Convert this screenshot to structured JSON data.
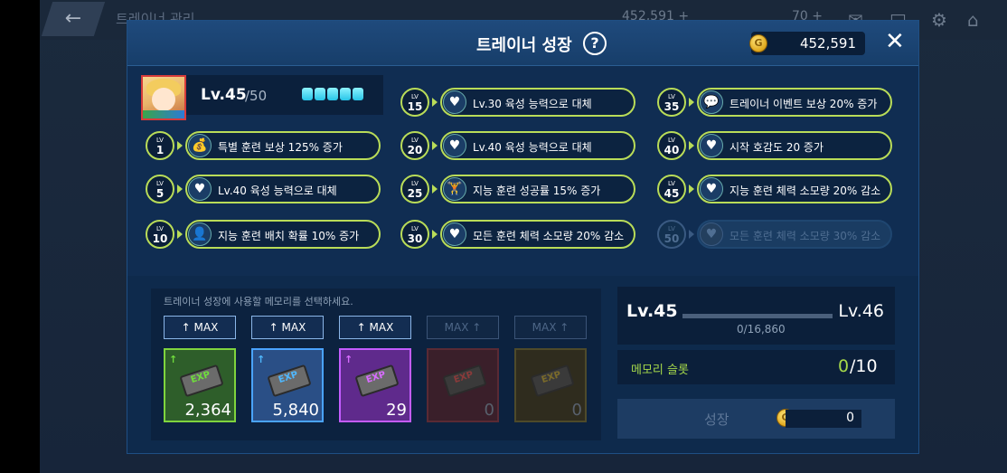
{
  "background": {
    "title": "트레이너 관리",
    "gold": "452,591 +",
    "stamina": "70 +"
  },
  "dialog": {
    "title": "트레이너 성장",
    "gold": "452,591"
  },
  "trainer": {
    "level": "Lv.45",
    "max_level": "/50",
    "gems": 5
  },
  "skills": [
    {
      "lv": "1",
      "icon": "💰",
      "text": "특별 훈련 보상 125% 증가",
      "locked": false
    },
    {
      "lv": "5",
      "icon": "♥",
      "text": "Lv.40 육성 능력으로 대체",
      "locked": false
    },
    {
      "lv": "10",
      "icon": "👤",
      "text": "지능 훈련 배치 확률 10% 증가",
      "locked": false
    },
    {
      "lv": "15",
      "icon": "♥",
      "text": "Lv.30 육성 능력으로 대체",
      "locked": false
    },
    {
      "lv": "20",
      "icon": "♥",
      "text": "Lv.40 육성 능력으로 대체",
      "locked": false
    },
    {
      "lv": "25",
      "icon": "🏋",
      "text": "지능 훈련 성공률 15% 증가",
      "locked": false
    },
    {
      "lv": "30",
      "icon": "♥",
      "text": "모든 훈련 체력 소모량 20% 감소",
      "locked": false
    },
    {
      "lv": "35",
      "icon": "💬",
      "text": "트레이너 이벤트 보상 20% 증가",
      "locked": false
    },
    {
      "lv": "40",
      "icon": "♥",
      "text": "시작 호감도 20 증가",
      "locked": false
    },
    {
      "lv": "45",
      "icon": "♥",
      "text": "지능 훈련 체력 소모량 20% 감소",
      "locked": false
    },
    {
      "lv": "50",
      "icon": "♥",
      "text": "모든 훈련 체력 소모량 30% 감소",
      "locked": true
    }
  ],
  "memory": {
    "hint": "트레이너 성장에 사용할 메모리를 선택하세요.",
    "buttons": [
      "↑ MAX",
      "↑ MAX",
      "↑ MAX",
      "MAX ↑",
      "MAX ↑"
    ],
    "chips": [
      {
        "label": "EXP",
        "count": "2,364",
        "color": "#6fdc3c",
        "border": "#7fd43e",
        "bg": "#2e5e2a",
        "dim": false
      },
      {
        "label": "EXP",
        "count": "5,840",
        "color": "#4fb8ff",
        "border": "#4aa3ff",
        "bg": "#2a4f86",
        "dim": false
      },
      {
        "label": "EXP",
        "count": "29",
        "color": "#d86cff",
        "border": "#c45cff",
        "bg": "#5f2a8c",
        "dim": false
      },
      {
        "label": "EXP",
        "count": "0",
        "color": "#8a3a3a",
        "border": "#5a2a34",
        "bg": "#3a1f2a",
        "dim": true
      },
      {
        "label": "EXP",
        "count": "0",
        "color": "#7a6a2a",
        "border": "#4e4a2a",
        "bg": "#2f2c1e",
        "dim": true
      }
    ]
  },
  "level": {
    "from": "Lv.45",
    "to": "Lv.46",
    "exp": "0/16,860",
    "progress": 0.0
  },
  "slot": {
    "label": "메모리 슬롯",
    "current": "0",
    "max": "/10"
  },
  "grow": {
    "label": "성장",
    "cost": "0"
  }
}
